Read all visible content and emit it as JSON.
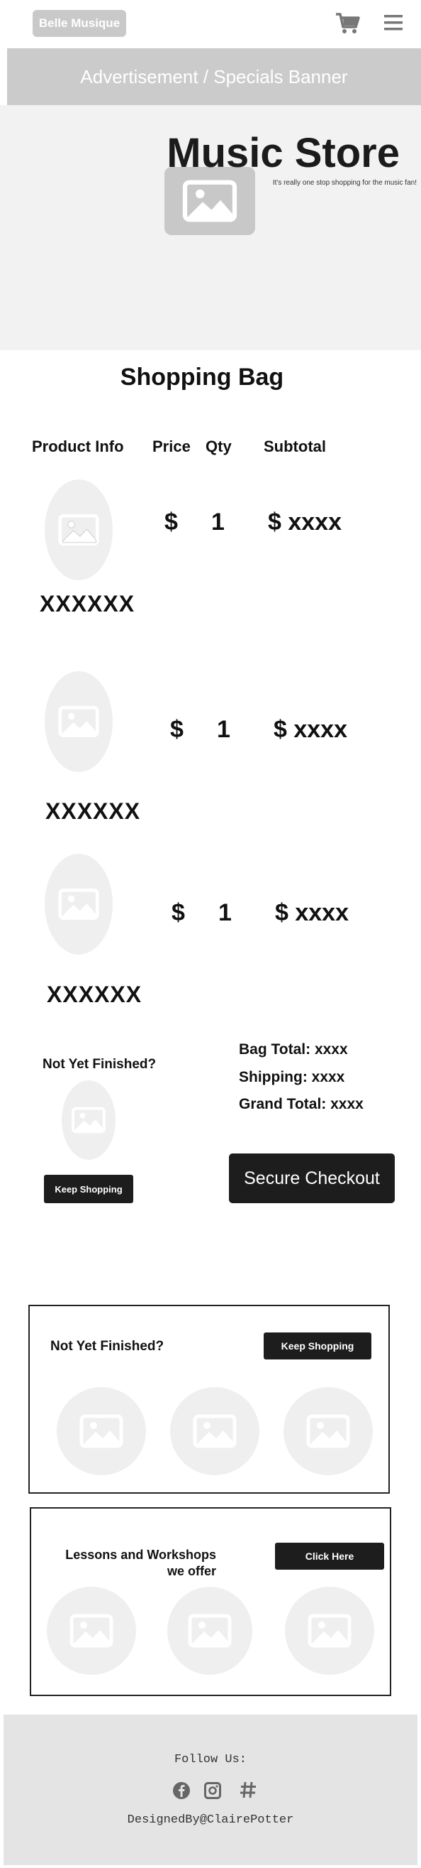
{
  "header": {
    "logo_label": "Belle Musique",
    "cart_icon": "cart-icon",
    "menu_icon": "hamburger-menu-icon"
  },
  "banner": {
    "text": "Advertisement / Specials Banner"
  },
  "hero": {
    "title": "Music Store",
    "tagline": "It's really one stop shopping for the music fan!"
  },
  "bag": {
    "title": "Shopping Bag",
    "columns": [
      "Product Info",
      "Price",
      "Qty",
      "Subtotal"
    ],
    "items": [
      {
        "name": "XXXXXX",
        "price": "$",
        "qty": "1",
        "subtotal": "$ xxxx"
      },
      {
        "name": "XXXXXX",
        "price": "$",
        "qty": "1",
        "subtotal": "$ xxxx"
      },
      {
        "name": "XXXXXX",
        "price": "$",
        "qty": "1",
        "subtotal": "$ xxxx"
      }
    ]
  },
  "not_finished": {
    "heading": "Not Yet Finished?",
    "button": "Keep Shopping"
  },
  "totals": {
    "bag_total": "Bag Total: xxxx",
    "shipping": "Shipping: xxxx",
    "grand_total": "Grand Total: xxxx",
    "checkout_button": "Secure Checkout"
  },
  "promo_shop": {
    "heading": "Not Yet Finished?",
    "button": "Keep Shopping"
  },
  "promo_lessons": {
    "heading_line1": "Lessons  and Workshops",
    "heading_line2": "we offer",
    "button": "Click Here"
  },
  "footer": {
    "follow": "Follow Us:",
    "icons": [
      "facebook-icon",
      "instagram-icon",
      "hashtag-icon"
    ],
    "credit": "DesignedBy@ClairePotter"
  }
}
